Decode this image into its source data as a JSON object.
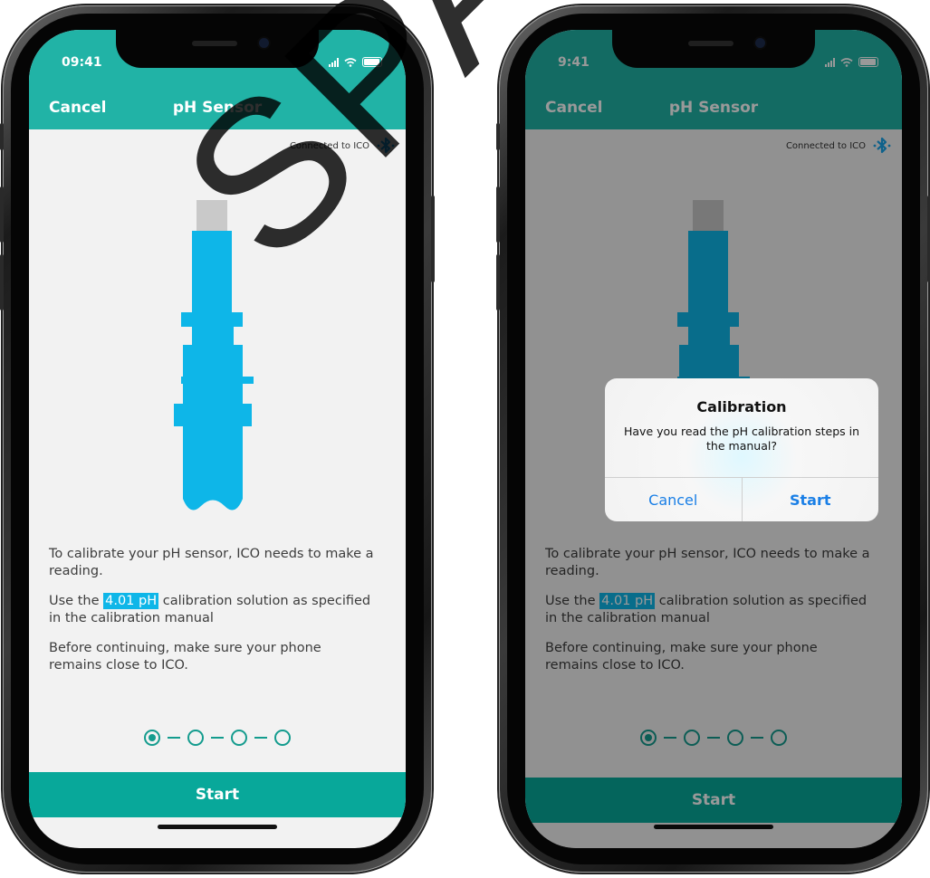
{
  "phones": [
    {
      "status_time": "09:41",
      "nav": {
        "cancel": "Cancel",
        "title": "pH Sensor"
      },
      "connected": "Connected to ICO",
      "instructions": {
        "p1": "To calibrate your pH sensor, ICO needs to make a reading.",
        "p2_before": "Use the",
        "p2_highlight": "4.01 pH",
        "p2_after": "calibration solution as specified in the calibration manual",
        "p3": "Before continuing, make sure your phone remains close to ICO."
      },
      "steps": {
        "total": 4,
        "current": 1
      },
      "start_label": "Start"
    },
    {
      "status_time": "9:41",
      "nav": {
        "cancel": "Cancel",
        "title": "pH Sensor"
      },
      "connected": "Connected to ICO",
      "instructions": {
        "p1": "To calibrate your pH sensor, ICO needs to make a reading.",
        "p2_before": "Use the",
        "p2_highlight": "4.01 pH",
        "p2_after": "calibration solution as specified in the calibration manual",
        "p3": "Before continuing, make sure your phone remains close to ICO."
      },
      "steps": {
        "total": 4,
        "current": 1
      },
      "start_label": "Start",
      "alert": {
        "title": "Calibration",
        "message": "Have you read the pH calibration steps in the manual?",
        "cancel": "Cancel",
        "confirm": "Start"
      }
    }
  ],
  "watermark": "SPARK",
  "colors": {
    "header": "#21b3a6",
    "accent": "#08a89a",
    "sensor": "#0eb6e8",
    "highlight": "#0eb6e8",
    "bluetooth": "#1aa3e8"
  },
  "icons": [
    "bluetooth-icon",
    "signal-icon",
    "wifi-icon",
    "battery-icon",
    "sensor-illustration"
  ]
}
